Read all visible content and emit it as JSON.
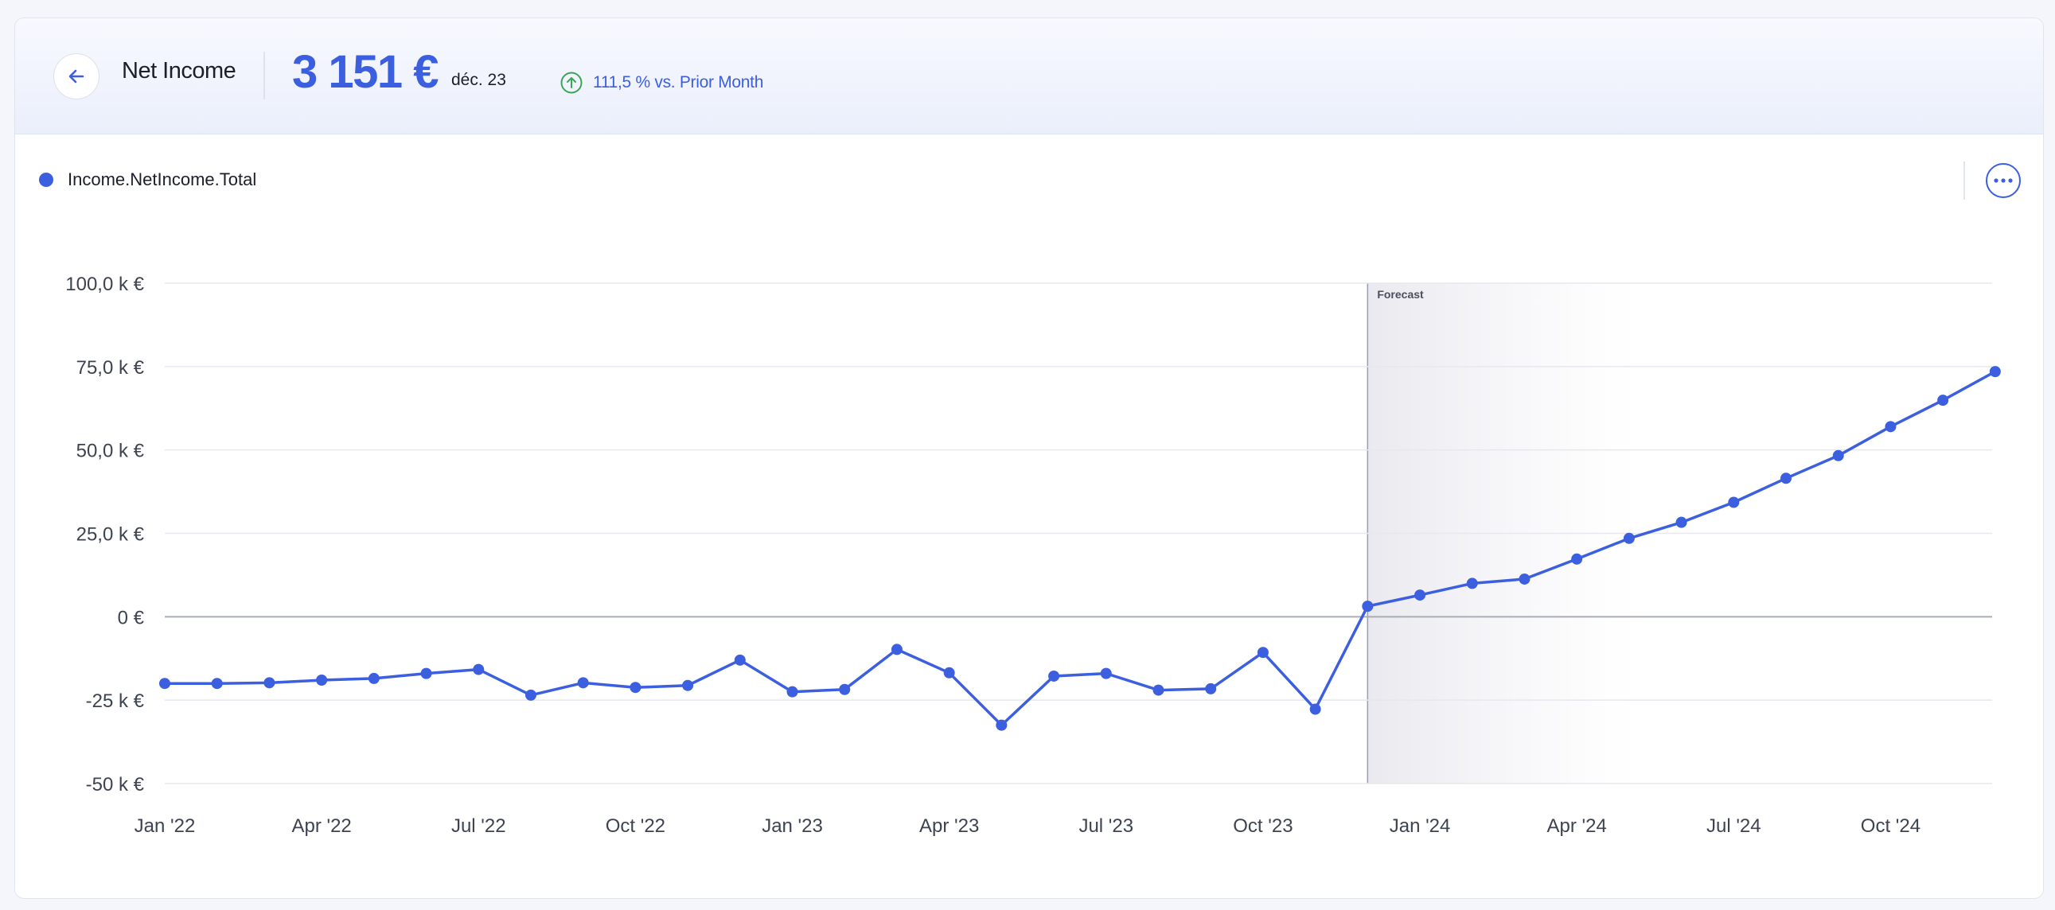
{
  "header": {
    "metric_name": "Net Income",
    "value": "3 151 €",
    "period": "déc. 23",
    "trend_text": "111,5 % vs. Prior Month",
    "trend_direction": "up",
    "trend_color": "#3aa655"
  },
  "icons": {
    "back": "arrow-left-icon",
    "trend": "arrow-up-circle-icon",
    "menu": "more-horizontal-icon"
  },
  "colors": {
    "accent": "#3c5fe0",
    "gridline": "#e6e8ee",
    "zero_line": "#a9adb6",
    "forecast_line": "#9a9db0"
  },
  "chart_data": {
    "type": "line",
    "series": [
      {
        "name": "Income.NetIncome.Total",
        "values": [
          -20000,
          -20000,
          -19800,
          -19000,
          -18500,
          -17000,
          -15800,
          -23500,
          -19800,
          -21200,
          -20600,
          -13000,
          -22500,
          -21800,
          -9800,
          -16800,
          -32500,
          -17800,
          -17000,
          -22000,
          -21600,
          -10700,
          -27700,
          3151,
          6500,
          10000,
          11300,
          17300,
          23500,
          28300,
          34300,
          41500,
          48300,
          57000,
          64900,
          73500
        ]
      }
    ],
    "x": [
      "2022-01",
      "2022-02",
      "2022-03",
      "2022-04",
      "2022-05",
      "2022-06",
      "2022-07",
      "2022-08",
      "2022-09",
      "2022-10",
      "2022-11",
      "2022-12",
      "2023-01",
      "2023-02",
      "2023-03",
      "2023-04",
      "2023-05",
      "2023-06",
      "2023-07",
      "2023-08",
      "2023-09",
      "2023-10",
      "2023-11",
      "2023-12",
      "2024-01",
      "2024-02",
      "2024-03",
      "2024-04",
      "2024-05",
      "2024-06",
      "2024-07",
      "2024-08",
      "2024-09",
      "2024-10",
      "2024-11",
      "2024-12"
    ],
    "x_ticks": [
      {
        "label": "Jan '22",
        "x": "2022-01"
      },
      {
        "label": "Apr '22",
        "x": "2022-04"
      },
      {
        "label": "Jul '22",
        "x": "2022-07"
      },
      {
        "label": "Oct '22",
        "x": "2022-10"
      },
      {
        "label": "Jan '23",
        "x": "2023-01"
      },
      {
        "label": "Apr '23",
        "x": "2023-04"
      },
      {
        "label": "Jul '23",
        "x": "2023-07"
      },
      {
        "label": "Oct '23",
        "x": "2023-10"
      },
      {
        "label": "Jan '24",
        "x": "2024-01"
      },
      {
        "label": "Apr '24",
        "x": "2024-04"
      },
      {
        "label": "Jul '24",
        "x": "2024-07"
      },
      {
        "label": "Oct '24",
        "x": "2024-10"
      }
    ],
    "y_ticks": [
      {
        "label": "100,0 k €",
        "value": 100000
      },
      {
        "label": "75,0 k €",
        "value": 75000
      },
      {
        "label": "50,0 k €",
        "value": 50000
      },
      {
        "label": "25,0 k €",
        "value": 25000
      },
      {
        "label": "0 €",
        "value": 0
      },
      {
        "label": "-25 k €",
        "value": -25000
      },
      {
        "label": "-50 k €",
        "value": -50000
      }
    ],
    "ylim": [
      -50000,
      100000
    ],
    "forecast_start": "2023-12",
    "forecast_label": "Forecast",
    "grid": true,
    "legend_position": "top-left"
  }
}
